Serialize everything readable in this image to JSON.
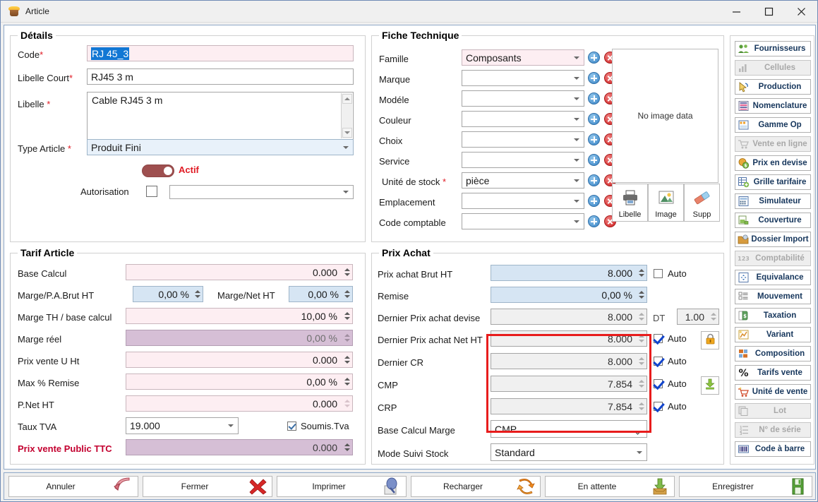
{
  "window": {
    "title": "Article",
    "icon": "package-icon",
    "minimize_label": "—",
    "maximize_label": "□",
    "close_label": "✕"
  },
  "details": {
    "legend": "Détails",
    "fields": {
      "code_label": "Code",
      "code_value": "RJ 45_3",
      "libelle_court_label": "Libelle Court",
      "libelle_court_value": "RJ45 3 m",
      "libelle_label": "Libelle",
      "libelle_value": "Cable RJ45 3 m",
      "type_article_label": "Type Article",
      "type_article_value": "Produit Fini",
      "actif_label": "Actif",
      "actif_state": "on",
      "autorisation_label": "Autorisation",
      "autorisation_checked": false,
      "autorisation_value": ""
    },
    "required_marker": "*"
  },
  "tarif": {
    "legend": "Tarif Article",
    "rows": [
      {
        "label": "Base Calcul",
        "value": "0.000"
      },
      {
        "label": "Marge/P.A.Brut HT",
        "value": "0,00 %"
      },
      {
        "label": "Marge/Net HT",
        "value": "0,00 %"
      },
      {
        "label": "Marge TH / base calcul",
        "value": "10,00 %"
      },
      {
        "label": "Marge réel",
        "value": "0,00 %"
      },
      {
        "label": "Prix vente U Ht",
        "value": "0.000"
      },
      {
        "label": "Max % Remise",
        "value": "0,00 %"
      },
      {
        "label": "P.Net HT",
        "value": "0.000"
      },
      {
        "label": "Taux TVA",
        "value": "19.000"
      },
      {
        "label": "Prix vente Public TTC",
        "value": "0.000"
      }
    ],
    "soumis_tva_label": "Soumis.Tva",
    "soumis_tva_checked": true
  },
  "fiche": {
    "legend": "Fiche Technique",
    "rows": [
      {
        "label": "Famille",
        "value": "Composants"
      },
      {
        "label": "Marque",
        "value": ""
      },
      {
        "label": "Modéle",
        "value": ""
      },
      {
        "label": "Couleur",
        "value": ""
      },
      {
        "label": "Choix",
        "value": ""
      },
      {
        "label": "Service",
        "value": ""
      },
      {
        "label": "Unité de stock",
        "value": "pièce"
      },
      {
        "label": "Emplacement",
        "value": ""
      },
      {
        "label": "Code comptable",
        "value": ""
      }
    ],
    "required_marker": "*",
    "image_placeholder": "No image data",
    "image_buttons": [
      {
        "label": "Libelle",
        "icon": "printer-icon"
      },
      {
        "label": "Image",
        "icon": "picture-icon"
      },
      {
        "label": "Supp",
        "icon": "eraser-icon"
      }
    ]
  },
  "prix_achat": {
    "legend": "Prix Achat",
    "rows": [
      {
        "label": "Prix achat Brut HT",
        "value": "8.000",
        "auto_label": "Auto",
        "auto_checked": false
      },
      {
        "label": "Remise",
        "value": "0,00 %",
        "auto_label": "",
        "auto_checked": null
      },
      {
        "label": "Dernier Prix achat devise",
        "value": "8.000",
        "auto_label": "",
        "auto_checked": null
      },
      {
        "label": "Dernier Prix achat Net HT",
        "value": "8.000",
        "auto_label": "Auto",
        "auto_checked": true
      },
      {
        "label": "Dernier CR",
        "value": "8.000",
        "auto_label": "Auto",
        "auto_checked": true
      },
      {
        "label": "CMP",
        "value": "7.854",
        "auto_label": "Auto",
        "auto_checked": true
      },
      {
        "label": "CRP",
        "value": "7.854",
        "auto_label": "Auto",
        "auto_checked": true
      }
    ],
    "devise_code": "DT",
    "devise_rate": "1.00",
    "base_calcul_marge_label": "Base Calcul Marge",
    "base_calcul_marge_value": "CMP",
    "mode_suivi_stock_label": "Mode Suivi Stock",
    "mode_suivi_stock_value": "Standard",
    "lock_icon": "lock-icon",
    "download_icon": "download-icon",
    "highlight_color": "#e81c1c"
  },
  "sidebar": {
    "items": [
      {
        "label": "Fournisseurs",
        "icon": "users-icon",
        "disabled": false
      },
      {
        "label": "Cellules",
        "icon": "bars-icon",
        "disabled": true
      },
      {
        "label": "Production",
        "icon": "cursor-icon",
        "disabled": false
      },
      {
        "label": "Nomenclature",
        "icon": "list-lines-icon",
        "disabled": false
      },
      {
        "label": "Gamme Op",
        "icon": "window-icon",
        "disabled": false
      },
      {
        "label": "Vente en ligne",
        "icon": "cart-icon",
        "disabled": true
      },
      {
        "label": "Prix en devise",
        "icon": "coins-icon",
        "disabled": false
      },
      {
        "label": "Grille tarifaire",
        "icon": "grid-plus-icon",
        "disabled": false
      },
      {
        "label": "Simulateur",
        "icon": "calculator-icon",
        "disabled": false
      },
      {
        "label": "Couverture",
        "icon": "box-arrow-icon",
        "disabled": false
      },
      {
        "label": "Dossier Import",
        "icon": "folder-box-icon",
        "disabled": false
      },
      {
        "label": "Comptabilité",
        "icon": "numbers-icon",
        "disabled": true
      },
      {
        "label": "Equivalance",
        "icon": "arrows-icon",
        "disabled": false
      },
      {
        "label": "Mouvement",
        "icon": "table-icon",
        "disabled": false
      },
      {
        "label": "Taxation",
        "icon": "money-tag-icon",
        "disabled": false
      },
      {
        "label": "Variant",
        "icon": "chart-star-icon",
        "disabled": false
      },
      {
        "label": "Composition",
        "icon": "blocks-icon",
        "disabled": false
      },
      {
        "label": "Tarifs vente",
        "icon": "percent-icon",
        "disabled": false
      },
      {
        "label": "Unité de vente",
        "icon": "cart-star-icon",
        "disabled": false
      },
      {
        "label": "Lot",
        "icon": "copy-icon",
        "disabled": true
      },
      {
        "label": "N° de série",
        "icon": "ordered-list-icon",
        "disabled": true
      },
      {
        "label": "Code à barre",
        "icon": "barcode-icon",
        "disabled": false
      }
    ]
  },
  "footer": {
    "buttons": [
      {
        "label": "Annuler",
        "icon": "undo-arrow-icon"
      },
      {
        "label": "Fermer",
        "icon": "red-x-icon"
      },
      {
        "label": "Imprimer",
        "icon": "printer-preview-icon"
      },
      {
        "label": "Recharger",
        "icon": "refresh-icon"
      },
      {
        "label": "En attente",
        "icon": "inbox-down-icon"
      },
      {
        "label": "Enregistrer",
        "icon": "save-disk-icon"
      }
    ]
  }
}
